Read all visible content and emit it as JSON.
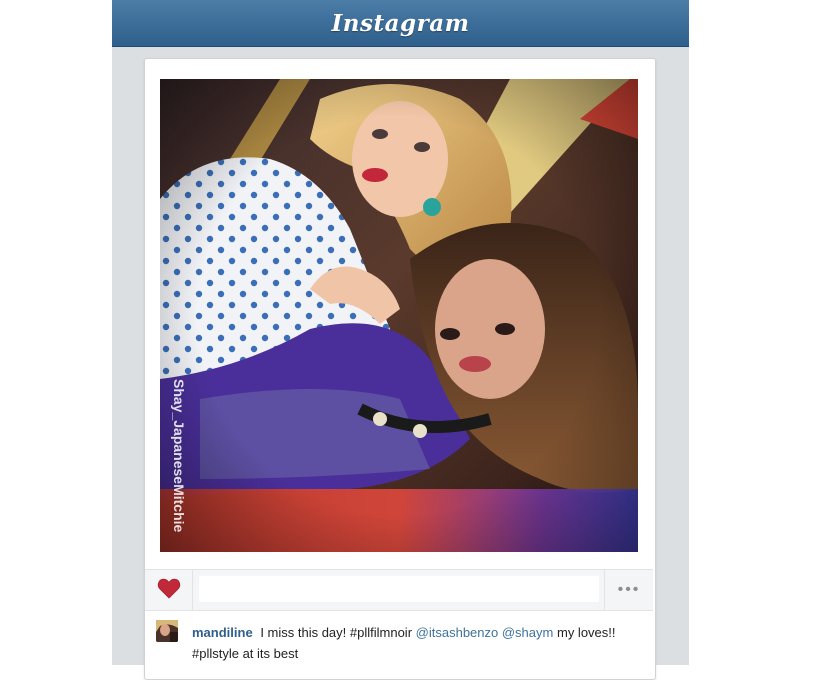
{
  "app": {
    "title": "Instagram"
  },
  "post": {
    "watermark": "Shay_JapaneseMitchie",
    "actions": {
      "like_icon": "heart-icon",
      "comment_placeholder": "",
      "more_icon": "ellipsis-icon",
      "more_label": "•••"
    },
    "caption": {
      "username": "mandiline",
      "text_part1": "I miss this day! #pllfilmnoir",
      "mention1": "@itsashbenzo",
      "mention2": "@shaym",
      "text_part2": "my loves!! #pllstyle at its best"
    }
  },
  "colors": {
    "header": "#3a6a96",
    "like": "#c0293a",
    "username": "#2f5f8c",
    "mention": "#3f729b"
  }
}
